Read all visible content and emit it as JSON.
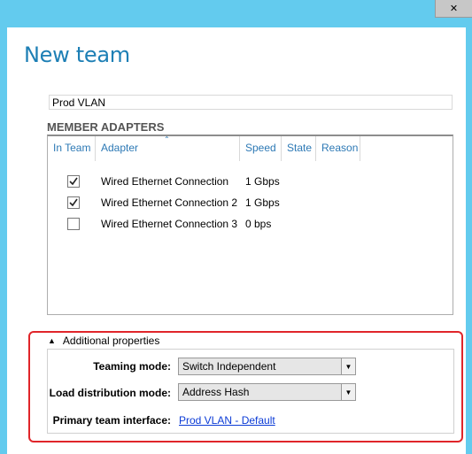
{
  "window": {
    "close_glyph": "✕"
  },
  "page": {
    "title": "New team"
  },
  "team_name": {
    "value": "Prod VLAN"
  },
  "member_adapters": {
    "section_title": "MEMBER ADAPTERS",
    "columns": {
      "in_team": "In Team",
      "adapter": "Adapter",
      "speed": "Speed",
      "state": "State",
      "reason": "Reason"
    },
    "sort_glyph": "⌃",
    "rows": [
      {
        "checked": true,
        "adapter": "Wired Ethernet Connection",
        "speed": "1 Gbps"
      },
      {
        "checked": true,
        "adapter": "Wired Ethernet Connection 2",
        "speed": "1 Gbps"
      },
      {
        "checked": false,
        "adapter": "Wired Ethernet Connection 3",
        "speed": "0 bps"
      }
    ]
  },
  "additional_properties": {
    "toggle_label": "Additional properties",
    "expanded_glyph": "▲",
    "teaming_mode": {
      "label": "Teaming mode:",
      "value": "Switch Independent"
    },
    "load_distribution": {
      "label": "Load distribution mode:",
      "value": "Address Hash"
    },
    "primary_interface": {
      "label": "Primary team interface:",
      "link": "Prod VLAN - Default"
    },
    "dropdown_glyph": "▼"
  },
  "colors": {
    "title_blue": "#1d7fb5",
    "highlight_red": "#e0252a",
    "link_blue": "#0b3bd6",
    "background": "#63cbee"
  }
}
